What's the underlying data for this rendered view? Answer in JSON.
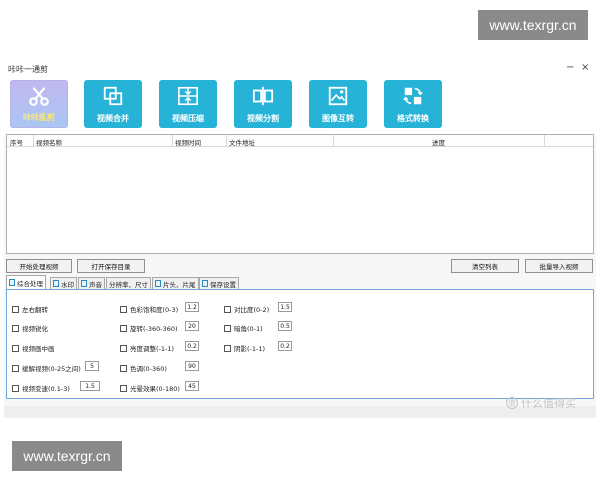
{
  "watermark": {
    "text": "www.texrgr.cn"
  },
  "window": {
    "title": "咔咔一通剪",
    "minimize": "−",
    "close": "×"
  },
  "toolbar": {
    "buttons": [
      {
        "label": "咔咔乱剪",
        "icon": "scissors-icon"
      },
      {
        "label": "视频合并",
        "icon": "merge-icon"
      },
      {
        "label": "视频压缩",
        "icon": "compress-icon"
      },
      {
        "label": "视频分割",
        "icon": "split-icon"
      },
      {
        "label": "图像互转",
        "icon": "image-convert-icon"
      },
      {
        "label": "格式转换",
        "icon": "format-convert-icon"
      }
    ]
  },
  "table": {
    "columns": [
      "序号",
      "视频名称",
      "视频时间",
      "文件地址",
      "进度"
    ]
  },
  "actions": {
    "start": "开始处理视频",
    "open_save_dir": "打开保存目录",
    "clear_list": "清空列表",
    "batch_import": "批量导入视频"
  },
  "tabs": [
    "综合处理",
    "水印",
    "声音",
    "分辨率、尺寸",
    "片头、片尾",
    "保存设置"
  ],
  "options": {
    "col1": [
      {
        "label": "左右翻转"
      },
      {
        "label": "视频锐化"
      },
      {
        "label": "视频画中画"
      },
      {
        "label": "缓解视频(0-25之间)",
        "value": "5"
      },
      {
        "label": "视频变速(0.1-3)",
        "value": "1.5"
      }
    ],
    "col2": [
      {
        "label": "色彩饱和度(0-3)",
        "value": "1.2"
      },
      {
        "label": "旋转(-360-360)",
        "value": "20"
      },
      {
        "label": "亮度调整(-1-1)",
        "value": "0.2"
      },
      {
        "label": "色调(0-360)",
        "value": "90"
      },
      {
        "label": "光晕效果(0-180)",
        "value": "45"
      }
    ],
    "col3": [
      {
        "label": "对比度(0-2)",
        "value": "1.5"
      },
      {
        "label": "暗角(0-1)",
        "value": "0.5"
      },
      {
        "label": "阴影(-1-1)",
        "value": "0.2"
      }
    ]
  },
  "stamp": {
    "badge": "值",
    "text": "什么值得买"
  }
}
